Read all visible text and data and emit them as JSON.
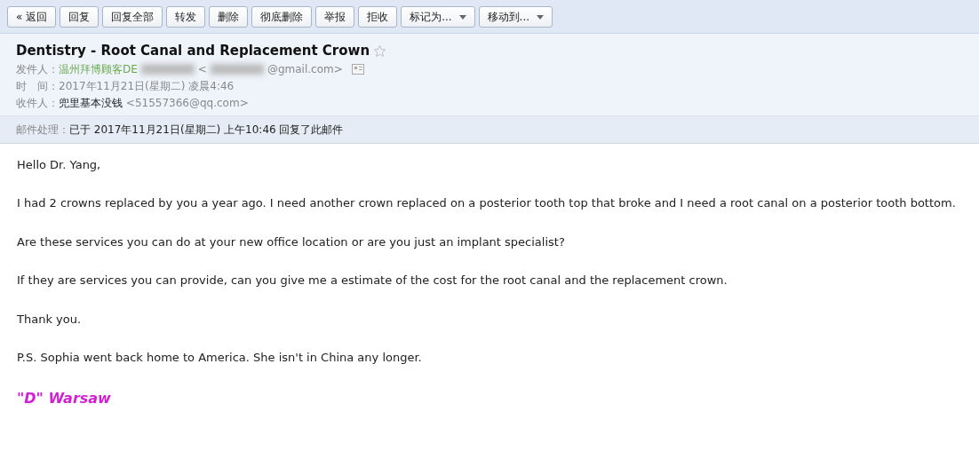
{
  "toolbar": [
    {
      "label": "« 返回",
      "kind": "plain"
    },
    {
      "label": "回复",
      "kind": "plain"
    },
    {
      "label": "回复全部",
      "kind": "plain"
    },
    {
      "label": "转发",
      "kind": "plain"
    },
    {
      "label": "删除",
      "kind": "plain"
    },
    {
      "label": "彻底删除",
      "kind": "plain"
    },
    {
      "label": "举报",
      "kind": "plain"
    },
    {
      "label": "拒收",
      "kind": "plain"
    },
    {
      "label": "标记为...",
      "kind": "dropdown"
    },
    {
      "label": "移动到...",
      "kind": "dropdown"
    }
  ],
  "header": {
    "subject": "Dentistry - Root Canal and Replacement Crown",
    "starred": false,
    "from_label": "发件人：",
    "from_name": "温州拜博顾客DE",
    "from_email_open": "<",
    "from_email": "@gmail.com>",
    "time_label": "时　间：",
    "time": "2017年11月21日(星期二) 凌晨4:46",
    "to_label": "收件人：",
    "to_name": "兜里基本没钱",
    "to_email": "<51557366@qq.com>"
  },
  "status": {
    "label": "邮件处理：",
    "text": "已于 2017年11月21日(星期二) 上午10:46 回复了此邮件"
  },
  "body": [
    "Hello Dr. Yang,",
    "I had 2 crowns replaced by you a year ago.  I need another crown replaced on a posterior tooth top that broke and I need a root canal on a posterior tooth bottom.",
    "Are these services you can do at your new office location or are you just an implant specialist?",
    "If they are services you can provide, can you give me a estimate of the cost for the root canal and the replacement crown.",
    "Thank you.",
    "P.S. Sophia went back home to America.  She isn't in China any longer."
  ],
  "signature": "\"D\" Warsaw"
}
